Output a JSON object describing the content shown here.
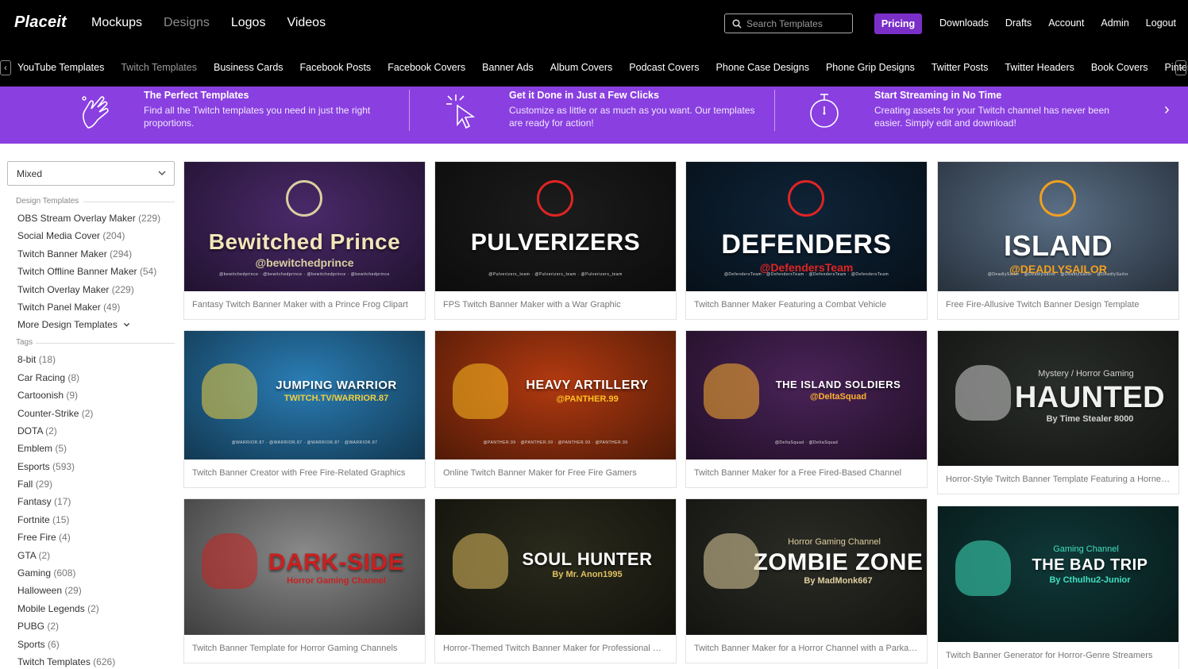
{
  "brand": {
    "logo": "Placeit"
  },
  "nav": {
    "main": [
      "Mockups",
      "Designs",
      "Logos",
      "Videos"
    ],
    "search_placeholder": "Search Templates",
    "pricing": "Pricing",
    "right": [
      "Downloads",
      "Drafts",
      "Account",
      "Admin",
      "Logout"
    ]
  },
  "categories": [
    "YouTube Templates",
    "Twitch Templates",
    "Business Cards",
    "Facebook Posts",
    "Facebook Covers",
    "Banner Ads",
    "Album Covers",
    "Podcast Covers",
    "Phone Case Designs",
    "Phone Grip Designs",
    "Twitter Posts",
    "Twitter Headers",
    "Book Covers",
    "Pinterest Pins"
  ],
  "promo": [
    {
      "title": "The Perfect Templates",
      "desc": "Find all the Twitch templates you need in just the right proportions.",
      "icon": "hand-ok-icon"
    },
    {
      "title": "Get it Done in Just a Few Clicks",
      "desc": "Customize as little or as much as you want. Our templates are ready for action!",
      "icon": "click-cursor-icon"
    },
    {
      "title": "Start Streaming in No Time",
      "desc": "Creating assets for your Twitch channel has never been easier. Simply edit and download!",
      "icon": "stopwatch-icon"
    }
  ],
  "sidebar": {
    "sort": "Mixed",
    "design_heading": "Design Templates",
    "design_templates": [
      {
        "label": "OBS Stream Overlay Maker",
        "count": "(229)"
      },
      {
        "label": "Social Media Cover",
        "count": "(204)"
      },
      {
        "label": "Twitch Banner Maker",
        "count": "(294)"
      },
      {
        "label": "Twitch Offline Banner Maker",
        "count": "(54)"
      },
      {
        "label": "Twitch Overlay Maker",
        "count": "(229)"
      },
      {
        "label": "Twitch Panel Maker",
        "count": "(49)"
      }
    ],
    "more_label": "More Design Templates",
    "tags_heading": "Tags",
    "tags": [
      {
        "label": "8-bit",
        "count": "(18)"
      },
      {
        "label": "Car Racing",
        "count": "(8)"
      },
      {
        "label": "Cartoonish",
        "count": "(9)"
      },
      {
        "label": "Counter-Strike",
        "count": "(2)"
      },
      {
        "label": "DOTA",
        "count": "(2)"
      },
      {
        "label": "Emblem",
        "count": "(5)"
      },
      {
        "label": "Esports",
        "count": "(593)"
      },
      {
        "label": "Fall",
        "count": "(29)"
      },
      {
        "label": "Fantasy",
        "count": "(17)"
      },
      {
        "label": "Fortnite",
        "count": "(15)"
      },
      {
        "label": "Free Fire",
        "count": "(4)"
      },
      {
        "label": "GTA",
        "count": "(2)"
      },
      {
        "label": "Gaming",
        "count": "(608)"
      },
      {
        "label": "Halloween",
        "count": "(29)"
      },
      {
        "label": "Mobile Legends",
        "count": "(2)"
      },
      {
        "label": "PUBG",
        "count": "(2)"
      },
      {
        "label": "Sports",
        "count": "(6)"
      },
      {
        "label": "Twitch Templates",
        "count": "(626)"
      }
    ]
  },
  "cards": [
    {
      "title": "Bewitched Prince",
      "sub": "@bewitchedprince",
      "social": "@bewitchedprince · @bewitchedprince · @bewitchedprince · @bewitchedprince",
      "caption": "Fantasy Twitch Banner Maker with a Prince Frog Clipart",
      "bg": "#4a2a6a",
      "fg": "#f2e6b8",
      "accent": "#d9cfa0"
    },
    {
      "title": "PULVERIZERS",
      "sub": "",
      "social": "@Pulverizers_team · @Pulverizers_team · @Pulverizers_team",
      "caption": "FPS Twitch Banner Maker with a War Graphic",
      "bg": "#1c1c1c",
      "fg": "#ffffff",
      "accent": "#e02424"
    },
    {
      "title": "DEFENDERS",
      "sub": "@DefendersTeam",
      "social": "@DefendersTeam · @DefendersTeam · @DefendersTeam · @DefendersTeam",
      "caption": "Twitch Banner Maker Featuring a Combat Vehicle",
      "bg": "#0f2438",
      "fg": "#ffffff",
      "accent": "#e02424"
    },
    {
      "title": "ISLAND",
      "sub": "@DEADLYSAILOR",
      "social": "@DeadlySailor · @DeadlySailor · @DeadlySailor · @DeadlySailor",
      "caption": "Free Fire-Allusive Twitch Banner Design Template",
      "bg": "#5a6f86",
      "fg": "#ffffff",
      "accent": "#f0a020"
    },
    {
      "title": "JUMPING WARRIOR",
      "sub": "TWITCH.TV/WARRIOR.87",
      "social": "@WARRIOR.87 · @WARRIOR.87 · @WARRIOR.87 · @WARRIOR.87",
      "caption": "Twitch Banner Creator with Free Fire-Related Graphics",
      "bg": "#2a7db5",
      "fg": "#ffffff",
      "accent": "#f0d040"
    },
    {
      "title": "HEAVY ARTILLERY",
      "sub": "@PANTHER.99",
      "social": "@PANTHER.99 · @PANTHER.99 · @PANTHER.99 · @PANTHER.99",
      "caption": "Online Twitch Banner Maker for Free Fire Gamers",
      "bg": "#b23a10",
      "fg": "#ffffff",
      "accent": "#ffc020"
    },
    {
      "title": "THE ISLAND SOLDIERS",
      "sub": "@DeltaSquad",
      "social": "@DeltaSquad · @DeltaSquad",
      "caption": "Twitch Banner Maker for a Free Fired-Based Channel",
      "bg": "#4a2358",
      "fg": "#ffffff",
      "accent": "#ffb030"
    },
    {
      "title": "HAUNTED",
      "sub": "By Time Stealer 8000",
      "top": "Mystery / Horror Gaming",
      "social": "",
      "caption": "Horror-Style Twitch Banner Template Featuring a Horned Skull",
      "bg": "#2a2e2a",
      "fg": "#f0f0f0",
      "accent": "#cfcfcf"
    },
    {
      "title": "DARK-SIDE",
      "sub": "Horror Gaming Channel",
      "social": "",
      "caption": "Twitch Banner Template for Horror Gaming Channels",
      "bg": "#8a8a8a",
      "fg": "#c82020",
      "accent": "#c82020"
    },
    {
      "title": "SOUL HUNTER",
      "sub": "By Mr. Anon1995",
      "social": "",
      "caption": "Horror-Themed Twitch Banner Maker for Professional Gamers",
      "bg": "#2a2a1c",
      "fg": "#ffffff",
      "accent": "#e0c060"
    },
    {
      "title": "ZOMBIE ZONE",
      "sub": "By MadMonk667",
      "top": "Horror Gaming Channel",
      "social": "",
      "caption": "Twitch Banner Maker for a Horror Channel with a Parka Clipart",
      "bg": "#2c2c26",
      "fg": "#ffffff",
      "accent": "#e0d0a0"
    },
    {
      "title": "THE BAD TRIP",
      "sub": "By Cthulhu2-Junior",
      "top": "Gaming Channel",
      "social": "",
      "caption": "Twitch Banner Generator for Horror-Genre Streamers",
      "bg": "#103838",
      "fg": "#ffffff",
      "accent": "#40e0c0"
    }
  ],
  "colors": {
    "accent": "#7b2fc9",
    "promo_bg": "#8a3fe0",
    "nav_bg": "#000000"
  }
}
